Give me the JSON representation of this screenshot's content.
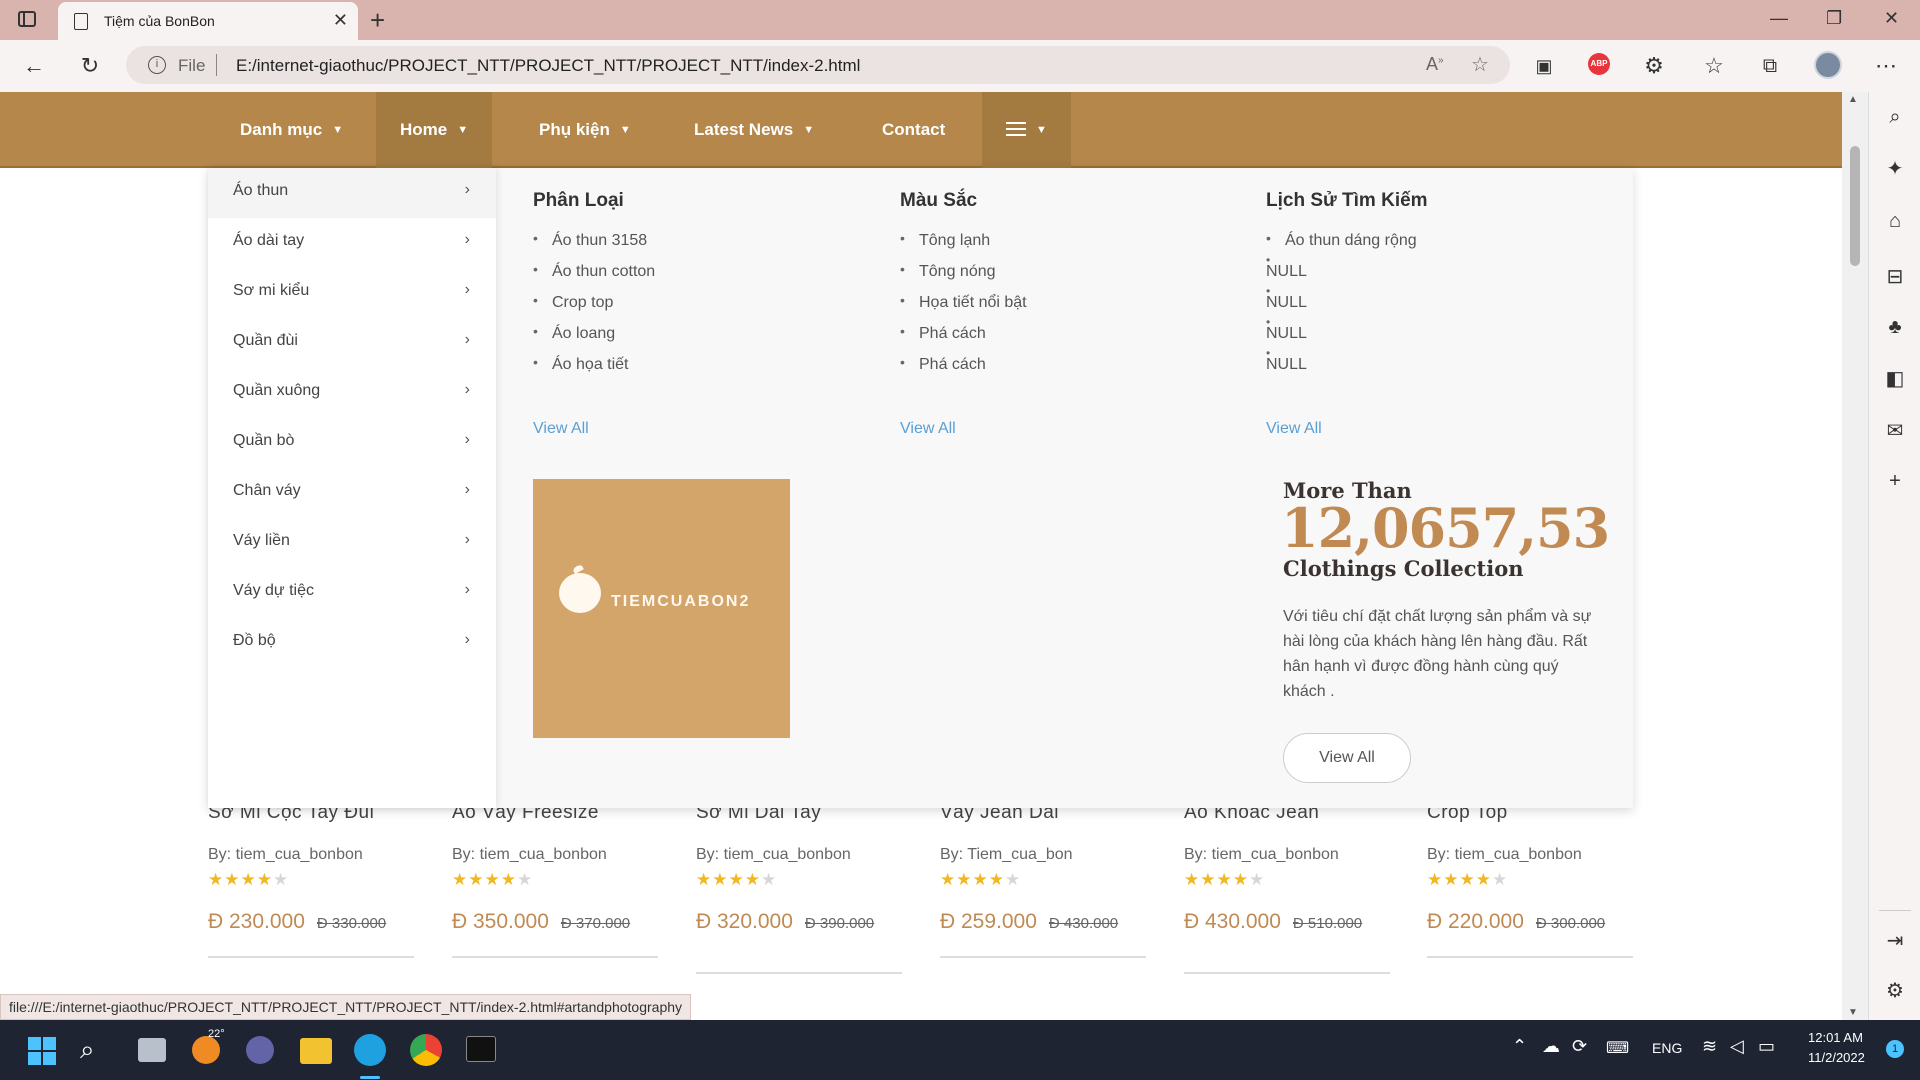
{
  "browser": {
    "tab_title": "Tiệm của BonBon",
    "address_scheme": "File",
    "address_url": "E:/internet-giaothuc/PROJECT_NTT/PROJECT_NTT/PROJECT_NTT/index-2.html",
    "status_url": "file:///E:/internet-giaothuc/PROJECT_NTT/PROJECT_NTT/PROJECT_NTT/index-2.html#artandphotography"
  },
  "nav": {
    "items": [
      "Danh mục",
      "Home",
      "Phụ kiện",
      "Latest News",
      "Contact"
    ]
  },
  "categories": [
    "Áo thun",
    "Áo dài tay",
    "Sơ mi kiểu",
    "Quần đùi",
    "Quần xuông",
    "Quần bò",
    "Chân váy",
    "Váy liền",
    "Váy dự tiệc",
    "Đồ bộ"
  ],
  "mega": {
    "col1": {
      "title": "Phân Loại",
      "items": [
        "Áo thun 3158",
        "Áo thun cotton",
        "Crop top",
        "Áo loang",
        "Áo họa tiết"
      ],
      "view_all": "View All"
    },
    "col2": {
      "title": "Màu Sắc",
      "items": [
        "Tông lạnh",
        "Tông nóng",
        "Họa tiết nổi bật",
        "Phá cách",
        "Phá cách"
      ],
      "view_all": "View All"
    },
    "col3": {
      "title": "Lịch Sử Tìm Kiếm",
      "items": [
        "Áo thun dáng rộng",
        "NULL",
        "NULL",
        "NULL",
        "NULL"
      ],
      "view_all": "View All"
    },
    "promo_logo_text": "TIEMCUABON2",
    "more_than": "More Than",
    "big_number": "12,0657,53",
    "collection": "Clothings Collection",
    "description": "Với tiêu chí đặt chất lượng sản phẩm và sự hài lòng của khách hàng lên hàng đầu. Rất hân hạnh vì được đồng hành cùng quý khách .",
    "button": "View All"
  },
  "products": [
    {
      "name": "Sơ Mi Cộc Tay Đũi",
      "by": "By: tiem_cua_bonbon",
      "stars": 4,
      "price": "Đ 230.000",
      "old": "Đ 330.000"
    },
    {
      "name": "Áo Váy Freesize",
      "by": "By: tiem_cua_bonbon",
      "stars": 4,
      "price": "Đ 350.000",
      "old": "Đ 370.000"
    },
    {
      "name": "Sơ Mi Dài Tay",
      "by": "By: tiem_cua_bonbon",
      "stars": 4,
      "price": "Đ 320.000",
      "old": "Đ 390.000"
    },
    {
      "name": "Váy Jean Dài",
      "by": "By: Tiem_cua_bon",
      "stars": 4,
      "price": "Đ 259.000",
      "old": "Đ 430.000"
    },
    {
      "name": "Áo Khoác Jean",
      "by": "By: tiem_cua_bonbon",
      "stars": 4,
      "price": "Đ 430.000",
      "old": "Đ 510.000"
    },
    {
      "name": "Crop Top",
      "by": "By: tiem_cua_bonbon",
      "stars": 4,
      "price": "Đ 220.000",
      "old": "Đ 300.000"
    }
  ],
  "taskbar": {
    "weather": "22°",
    "language": "ENG",
    "time": "12:01 AM",
    "date": "11/2/2022",
    "notifications": "1"
  }
}
